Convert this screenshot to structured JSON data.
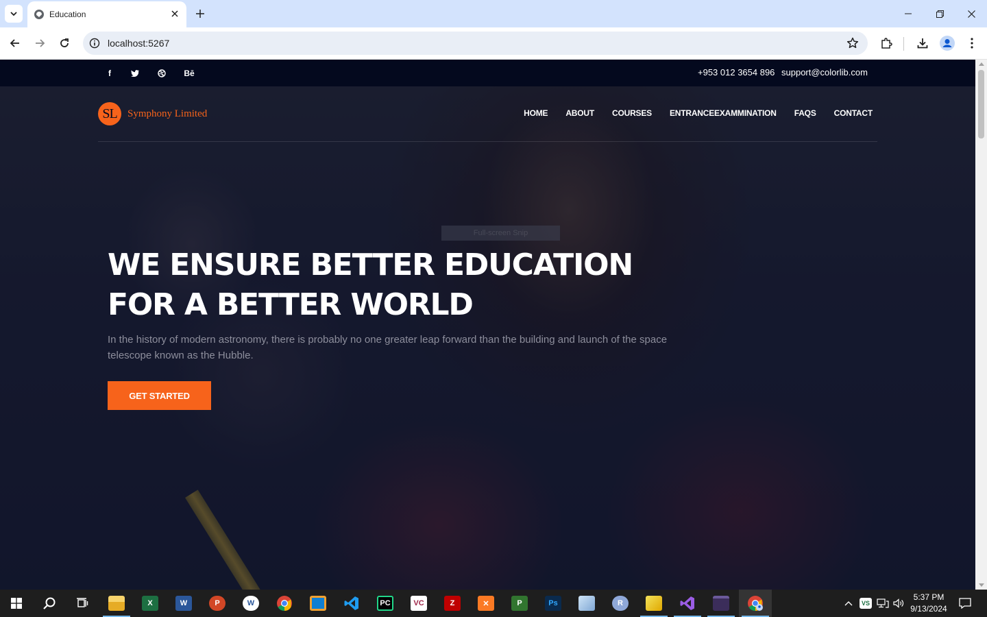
{
  "browser": {
    "tab_title": "Education",
    "url": "localhost:5267"
  },
  "site": {
    "phone": "+953 012 3654 896",
    "email": "support@colorlib.com",
    "social": [
      "f",
      "t",
      "d",
      "Bē"
    ],
    "logo_initials": "SL",
    "logo_name": "Symphony Limited",
    "menu": [
      "HOME",
      "ABOUT",
      "COURSES",
      "ENTRANCEEXAMMINATION",
      "FAQS",
      "CONTACT"
    ],
    "overlay_hint": "Full-screen Snip",
    "hero_title_line1": "WE ENSURE BETTER EDUCATION",
    "hero_title_line2": "FOR A BETTER WORLD",
    "hero_text": "In the history of modern astronomy, there is probably no one greater leap forward than the building and launch of the space telescope known as the Hubble.",
    "cta_label": "GET STARTED"
  },
  "taskbar": {
    "time": "5:37 PM",
    "date": "9/13/2024",
    "apps": [
      "file-explorer",
      "excel",
      "word",
      "powerpoint",
      "word-alt",
      "chrome",
      "remote-desktop",
      "vscode",
      "pycharm",
      "visual-studio-code-alt",
      "filezilla",
      "xampp",
      "project",
      "photoshop",
      "cube-app",
      "r-app",
      "teams-alt",
      "visual-studio",
      "terminal",
      "chrome-profile"
    ]
  },
  "colors": {
    "accent": "#f7631b",
    "topbar": "#04091e",
    "chrome_tabbar": "#d3e3fd"
  }
}
